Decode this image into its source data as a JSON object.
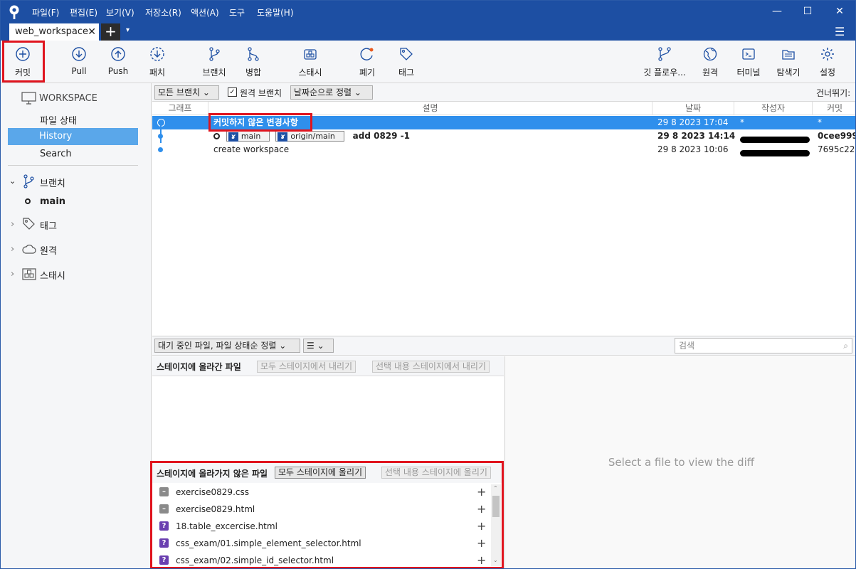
{
  "menu": [
    "파일(F)",
    "편집(E)",
    "보기(V)",
    "저장소(R)",
    "액션(A)",
    "도구",
    "도움말(H)"
  ],
  "window_controls": {
    "minimize": "—",
    "maximize": "☐",
    "close": "✕"
  },
  "tab": {
    "title": "web_workspace",
    "close": "✕",
    "new": "+",
    "dropdown": "▾"
  },
  "toolbar": {
    "commit": "커밋",
    "pull": "Pull",
    "push": "Push",
    "patch": "패치",
    "branch": "브랜치",
    "merge": "병합",
    "stash": "스태시",
    "discard": "폐기",
    "tag": "태그",
    "gitflow": "깃 플로우...",
    "remote": "원격",
    "terminal": "터미널",
    "explorer": "탐색기",
    "settings": "설정"
  },
  "sidebar": {
    "workspace": "WORKSPACE",
    "file_status": "파일 상태",
    "history": "History",
    "search": "Search",
    "branches": "브랜치",
    "branch_main": "main",
    "tags": "태그",
    "remotes": "원격",
    "stashes": "스태시"
  },
  "filter": {
    "all_branches": "모든 브랜치 ⌄",
    "remote_branches_checked": "✓",
    "remote_branches": "원격 브랜치",
    "sort_by_date": "날짜순으로 정렬 ⌄",
    "jump_to": "건너뛰기:"
  },
  "columns": {
    "graph": "그래프",
    "description": "설명",
    "date": "날짜",
    "author": "작성자",
    "commit": "커밋"
  },
  "commits": [
    {
      "description": "커밋하지 않은 변경사항",
      "date": "29 8 2023 17:04",
      "author": "*",
      "hash": "*"
    },
    {
      "branch_local": "main",
      "branch_remote": "origin/main",
      "description": "add 0829 -1",
      "date": "29 8 2023 14:14",
      "hash": "0cee999"
    },
    {
      "description": "create workspace",
      "date": "29 8 2023 10:06",
      "hash": "7695c22"
    }
  ],
  "lower": {
    "sort_pending": "대기 중인 파일, 파일 상태순 정렬 ⌄",
    "list_mode": "☰ ⌄",
    "search_placeholder": "검색",
    "staged_title": "스테이지에 올라간 파일",
    "unstage_all": "모두 스테이지에서 내리기",
    "unstage_selected": "선택 내용 스테이지에서 내리기",
    "unstaged_title": "스테이지에 올라가지 않은 파일",
    "stage_all": "모두 스테이지에 올리기",
    "stage_selected": "선택 내용 스테이지에 올리기",
    "diff_placeholder": "Select a file to view the diff"
  },
  "unstaged_files": [
    {
      "name": "exercise0829.css",
      "status": "removed",
      "icon": "–"
    },
    {
      "name": "exercise0829.html",
      "status": "removed",
      "icon": "–"
    },
    {
      "name": "18.table_excercise.html",
      "status": "untracked",
      "icon": "?"
    },
    {
      "name": "css_exam/01.simple_element_selector.html",
      "status": "untracked",
      "icon": "?"
    },
    {
      "name": "css_exam/02.simple_id_selector.html",
      "status": "untracked",
      "icon": "?"
    }
  ],
  "colors": {
    "titlebar": "#1d4fa3",
    "selection": "#2f8fec",
    "highlight_red": "#e0141e",
    "removed": "#8a8a8a",
    "untracked": "#6a3fb0"
  }
}
